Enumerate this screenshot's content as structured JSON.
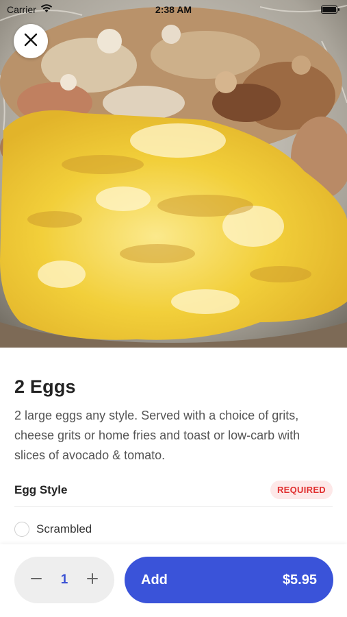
{
  "status_bar": {
    "carrier": "Carrier",
    "time": "2:38 AM"
  },
  "hero": {
    "image_subject": "eggs-and-home-fries-photo"
  },
  "item": {
    "title": "2 Eggs",
    "description": "2 large eggs any style. Served with a choice of grits, cheese grits or home fries and toast or low-carb with slices of avocado & tomato."
  },
  "options_section": {
    "title": "Egg Style",
    "badge": "REQUIRED",
    "options": [
      {
        "label": "Scrambled"
      }
    ]
  },
  "order_bar": {
    "quantity": "1",
    "add_label": "Add",
    "price": "$5.95"
  },
  "colors": {
    "accent": "#3a53d9",
    "required_text": "#e02f2f",
    "required_bg": "#fde8e8"
  },
  "icons": [
    "close-icon",
    "minus-icon",
    "plus-icon",
    "wifi-icon",
    "battery-icon"
  ]
}
